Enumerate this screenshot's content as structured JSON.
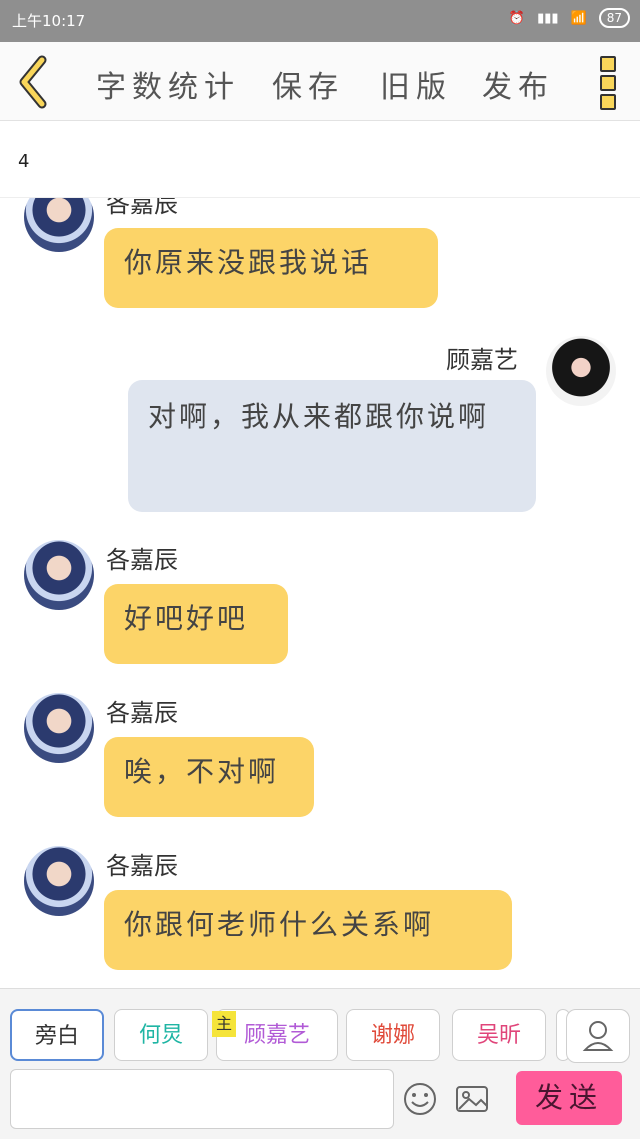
{
  "status_bar": {
    "time": "上午10:17",
    "battery": "87"
  },
  "toolbar": {
    "items": [
      "字数统计",
      "保存",
      "旧版",
      "发布"
    ]
  },
  "subbar": {
    "count": "4"
  },
  "messages": [
    {
      "sender": "各嘉辰",
      "side": "left",
      "text": "你原来没跟我说话"
    },
    {
      "sender": "顾嘉艺",
      "side": "right",
      "text": "对啊，我从来都跟你说啊"
    },
    {
      "sender": "各嘉辰",
      "side": "left",
      "text": "好吧好吧"
    },
    {
      "sender": "各嘉辰",
      "side": "left",
      "text": "唉，不对啊"
    },
    {
      "sender": "各嘉辰",
      "side": "left",
      "text": "你跟何老师什么关系啊"
    }
  ],
  "role_chips": [
    {
      "label": "旁白",
      "color": "#333333"
    },
    {
      "label": "何炅",
      "color": "#1fb5a4"
    },
    {
      "label": "顾嘉艺",
      "color": "#b15ad6"
    },
    {
      "label": "谢娜",
      "color": "#e04a3a"
    },
    {
      "label": "吴昕",
      "color": "#e0457a"
    }
  ],
  "main_badge": "主",
  "send_label": "发送"
}
